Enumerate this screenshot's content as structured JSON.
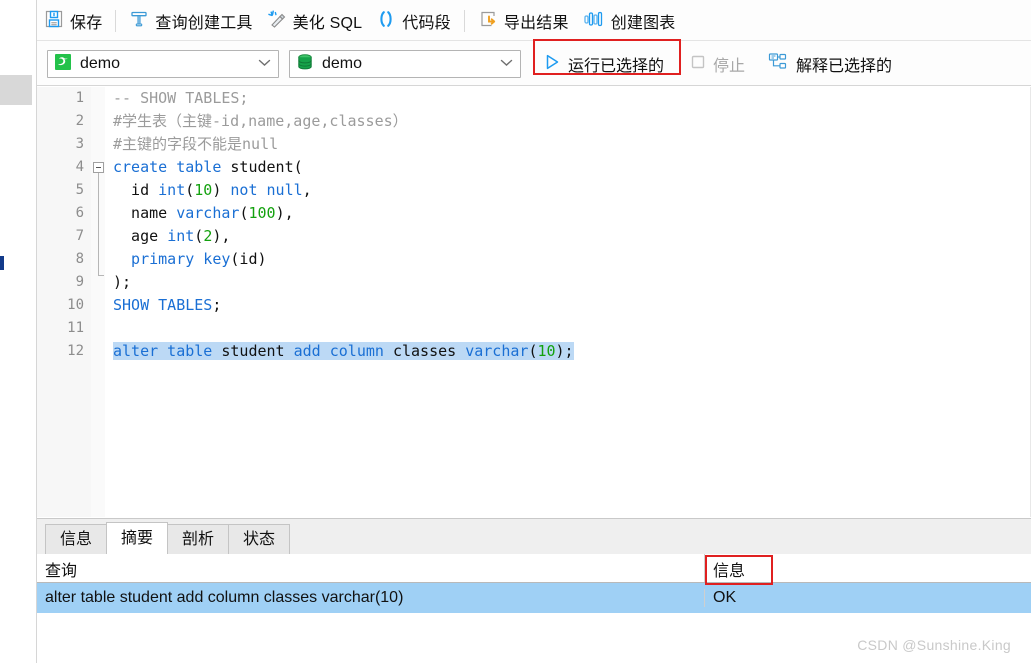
{
  "toolbar": {
    "items": [
      {
        "icon": "save-icon",
        "label": "保存"
      },
      {
        "icon": "query-builder-icon",
        "label": "查询创建工具"
      },
      {
        "icon": "beautify-sql-icon",
        "label": "美化 SQL"
      },
      {
        "icon": "code-snippet-icon",
        "label": "代码段"
      },
      {
        "icon": "export-result-icon",
        "label": "导出结果"
      },
      {
        "icon": "create-chart-icon",
        "label": "创建图表"
      }
    ]
  },
  "second_bar": {
    "connection": {
      "icon": "mysql-dolphin-icon",
      "value": "demo",
      "chevron": "chevron-down-icon"
    },
    "database": {
      "icon": "database-icon",
      "value": "demo",
      "chevron": "chevron-down-icon"
    },
    "run_selected": {
      "icon": "play-icon",
      "label": "运行已选择的",
      "highlight_color": "#e02020"
    },
    "stop": {
      "icon": "stop-icon",
      "label": "停止",
      "disabled": true
    },
    "explain_selected": {
      "icon": "explain-plan-icon",
      "label": "解释已选择的"
    }
  },
  "editor": {
    "line_numbers": [
      "1",
      "2",
      "3",
      "4",
      "5",
      "6",
      "7",
      "8",
      "9",
      "10",
      "11",
      "12"
    ],
    "lines": [
      {
        "n": 1,
        "text": "-- SHOW TABLES;"
      },
      {
        "n": 2,
        "text": "#学生表（主键-id,name,age,classes）"
      },
      {
        "n": 3,
        "text": "#主键的字段不能是null"
      },
      {
        "n": 4,
        "text": "create table student("
      },
      {
        "n": 5,
        "text": "  id int(10) not null,"
      },
      {
        "n": 6,
        "text": "  name varchar(100),"
      },
      {
        "n": 7,
        "text": "  age int(2),"
      },
      {
        "n": 8,
        "text": "  primary key(id)"
      },
      {
        "n": 9,
        "text": ");"
      },
      {
        "n": 10,
        "text": "SHOW TABLES;"
      },
      {
        "n": 11,
        "text": ""
      },
      {
        "n": 12,
        "text": "alter table student add column classes varchar(10);"
      }
    ],
    "selected_line": 12,
    "colors": {
      "keyword": "#1a6fd4",
      "number": "#13a10e",
      "comment": "#9b9b9b",
      "selection": "#bcd9f5"
    }
  },
  "result_tabs": [
    {
      "label": "信息",
      "active": false
    },
    {
      "label": "摘要",
      "active": true
    },
    {
      "label": "剖析",
      "active": false
    },
    {
      "label": "状态",
      "active": false
    }
  ],
  "result_grid": {
    "columns": [
      "查询",
      "信息"
    ],
    "rows": [
      {
        "query": "alter table student add column classes varchar(10)",
        "info": "OK"
      }
    ],
    "highlight_color": "#e02020",
    "row_selection_color": "#9fd0f5"
  },
  "watermark": "CSDN @Sunshine.King"
}
